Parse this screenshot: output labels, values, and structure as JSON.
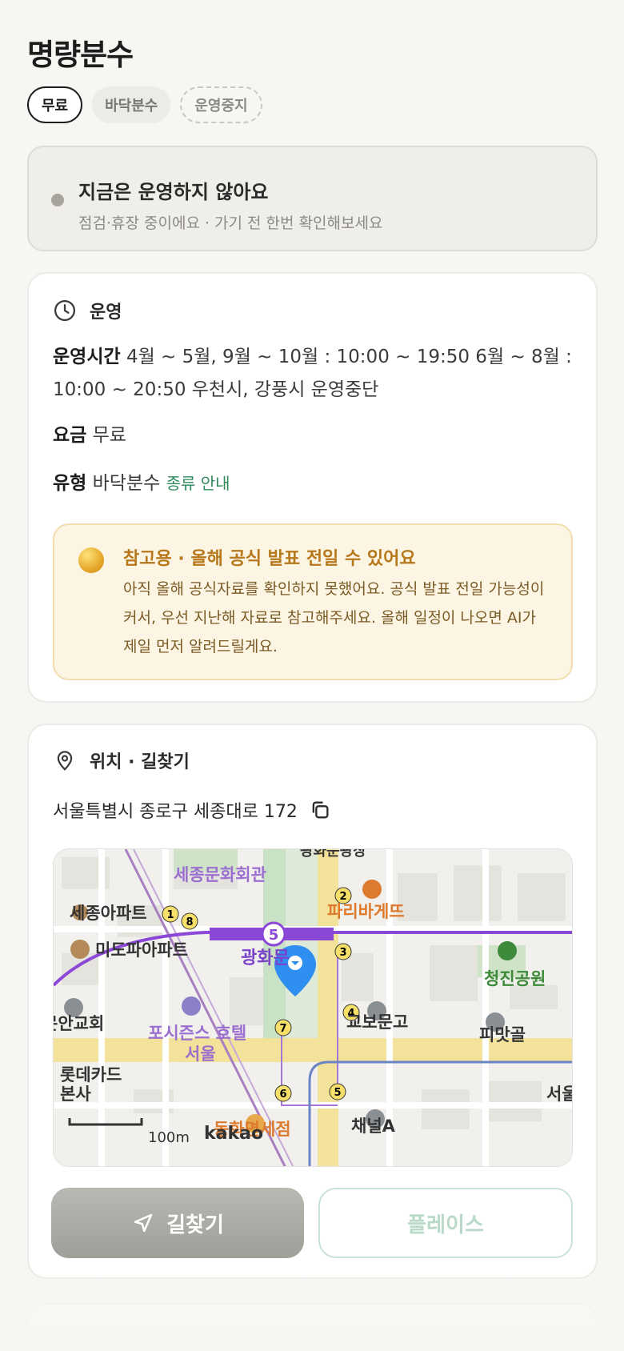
{
  "page_title": "명량분수",
  "chips": [
    {
      "label": "무료"
    },
    {
      "label": "바닥분수"
    },
    {
      "label": "운영중지"
    }
  ],
  "status": {
    "heading": "지금은 운영하지 않아요",
    "subtext": "점검·휴장 중이에요 · 가기 전 한번 확인해보세요"
  },
  "operation": {
    "section_title": "운영",
    "hours_label": "운영시간",
    "hours_value": "4월 ~ 5월, 9월 ~ 10월 : 10:00 ~ 19:50 6월 ~ 8월 : 10:00 ~ 20:50 우천시, 강풍시 운영중단",
    "fee_label": "요금",
    "fee_value": "무료",
    "type_label": "유형",
    "type_value": "바닥분수",
    "type_link": "종류 안내"
  },
  "notice": {
    "heading": "참고용 · 올해 공식 발표 전일 수 있어요",
    "body": "아직 올해 공식자료를 확인하지 못했어요. 공식 발표 전일 가능성이 커서, 우선 지난해 자료로 참고해주세요. 올해 일정이 나오면 AI가 제일 먼저 알려드릴게요."
  },
  "location": {
    "section_title": "위치 · 길찾기",
    "address": "서울특별시 종로구 세종대로 172"
  },
  "map": {
    "labels": {
      "sejong_center": "세종문화회관",
      "top_cut": "광화문광장",
      "sejong_apt": "세종아파트",
      "mido_apt": "미도파아파트",
      "paris": "파리바게뜨",
      "gwanghwamun": "광화문",
      "cheongjin": "청진공원",
      "church": "문안교회",
      "four_seasons": "포시즌스 호텔",
      "four_seasons_2": "서울",
      "kyobo": "교보문고",
      "pimatgol": "피맛골",
      "lotte_card": "롯데카드",
      "lotte_card_2": "본사",
      "dutyfree": "동화면세점",
      "channel_a": "채널A",
      "seoul_cut": "서울",
      "line5": "5",
      "scale": "100m",
      "brand": "kakao"
    },
    "exits": [
      "1",
      "8",
      "2",
      "3",
      "4",
      "7",
      "6",
      "5"
    ]
  },
  "buttons": {
    "directions": "길찾기",
    "place": "플레이스"
  },
  "colors": {
    "accent_green": "#2f8a5c",
    "notice_gold": "#b6781a",
    "map_pin": "#2f8ff0",
    "subway_line5": "#8b48d6"
  }
}
